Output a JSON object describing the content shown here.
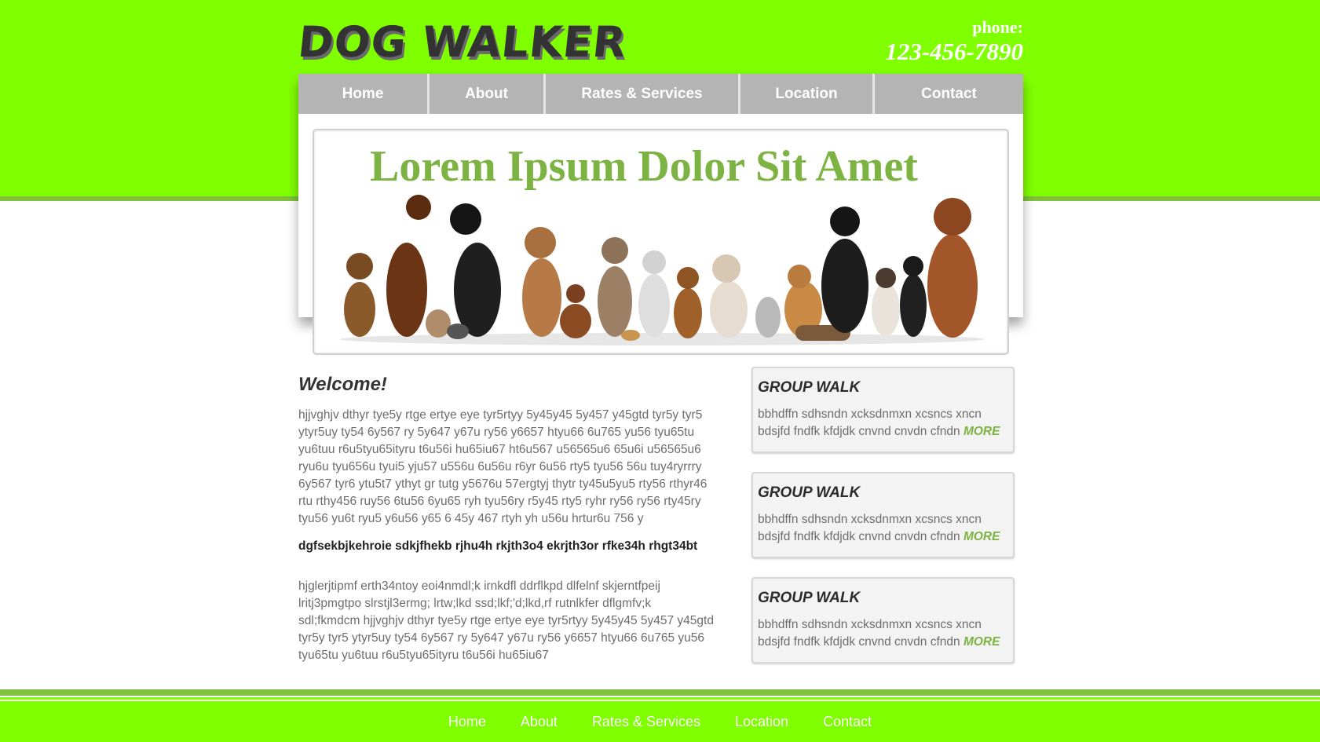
{
  "header": {
    "logo_text": "DOG WALKER",
    "phone_label": "phone:",
    "phone_number": "123-456-7890"
  },
  "nav": {
    "items": [
      "Home",
      "About",
      "Rates & Services",
      "Location",
      "Contact"
    ]
  },
  "banner": {
    "title": "Lorem Ipsum Dolor Sit Amet",
    "image_semantic": "group of dogs and pets"
  },
  "main": {
    "welcome": "Welcome!",
    "paragraph_1": "hjjvghjv dthyr tye5y rtge ertye eye tyr5rtyy 5y45y45 5y457 y45gtd tyr5y tyr5 ytyr5uy ty54 6y567 ry 5y647 y67u ry56 y6657 htyu66 6u765 yu56 tyu65tu yu6tuu r6u5tyu65ityru t6u56i hu65iu67 ht6u567 u56565u6 65u6i u56565u6 ryu6u tyu656u tyui5 yju57 u556u 6u56u r6yr 6u56 rty5 tyu56 56u tuy4ryrrry 6y567 tyr6 ytu5t7 ythyt gr tutg y5676u 57ergtyj thytr ty45u5yu5 rty56 rthyr46 rtu rthy456 ruy56 6tu56 6yu65 ryh tyu56ry r5y45 rty5 ryhr ry56 ry56 rty45ry tyu56 yu6t ryu5 y6u56 y65 6 45y 467 rtyh yh u56u hrtur6u 756 y",
    "subheading": "dgfsekbjkehroie sdkjfhekb rjhu4h rkjth3o4 ekrjth3or rfke34h rhgt34bt",
    "paragraph_2": "hjglerjtipmf erth34ntoy eoi4nmdl;k irnkdfl ddrflkpd dlfelnf skjerntfpeij lritj3pmgtpo slrstjl3ermg; lrtw;lkd ssd;lkf;'d;lkd,rf rutnlkfer dflgmfv;k sdl;fkmdcm hjjvghjv dthyr tye5y rtge ertye eye tyr5rtyy 5y45y45 5y457 y45gtd tyr5y tyr5 ytyr5uy ty54 6y567 ry 5y647 y67u ry56 y6657 htyu66 6u765 yu56 tyu65tu yu6tuu r6u5tyu65ityru t6u56i hu65iu67"
  },
  "sidebar": {
    "cards": [
      {
        "title": "GROUP WALK",
        "text": "bbhdffn sdhsndn xcksdnmxn xcsncs xncn bdsjfd fndfk kfdjdk cnvnd cnvdn cfndn",
        "more": "MORE"
      },
      {
        "title": "GROUP WALK",
        "text": "bbhdffn sdhsndn xcksdnmxn xcsncs xncn bdsjfd fndfk kfdjdk cnvnd cnvdn cfndn",
        "more": "MORE"
      },
      {
        "title": "GROUP WALK",
        "text": "bbhdffn sdhsndn xcksdnmxn xcsncs xncn bdsjfd fndfk kfdjdk cnvnd cnvdn cfndn",
        "more": "MORE"
      }
    ]
  },
  "footer": {
    "links": [
      "Home",
      "About",
      "Rates & Services",
      "Location",
      "Contact"
    ]
  },
  "colors": {
    "brand_green": "#80ff00",
    "accent_green": "#7cb342",
    "nav_gray": "#b4b4b4"
  }
}
